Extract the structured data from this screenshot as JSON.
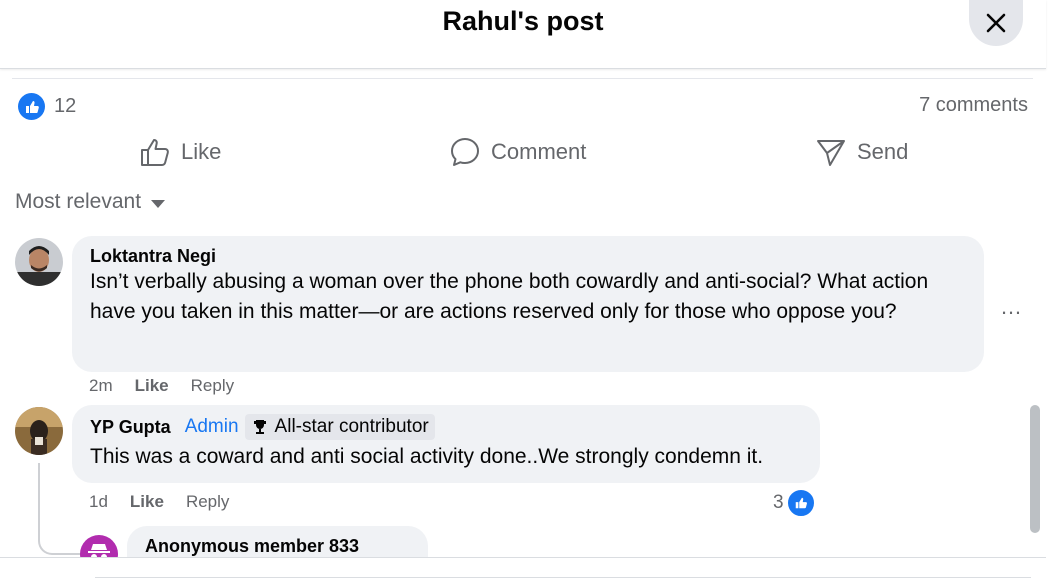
{
  "header": {
    "title": "Rahul's post"
  },
  "stats": {
    "reaction_count": "12",
    "comments_count": "7 comments"
  },
  "actions": {
    "like": "Like",
    "comment": "Comment",
    "send": "Send"
  },
  "sort": {
    "label": "Most relevant"
  },
  "comments": [
    {
      "author": "Loktantra Negi",
      "text": "Isn’t verbally abusing a woman over the phone both cowardly and anti-social? What action have you taken in this matter—or are actions reserved only for those who oppose you?",
      "time": "2m",
      "like": "Like",
      "reply": "Reply",
      "more": "…"
    },
    {
      "author": "YP Gupta",
      "role": "Admin",
      "badge": "All-star contributor",
      "text": "This was a coward and anti social activity done..We strongly condemn it.",
      "time": "1d",
      "like": "Like",
      "reply": "Reply",
      "reactions": "3"
    },
    {
      "author": "Anonymous member 833"
    }
  ],
  "colors": {
    "accent": "#1877f2",
    "bubble": "#f0f2f5",
    "muted": "#65676b"
  },
  "icons": [
    "close-icon",
    "like-reaction-icon",
    "thumbs-up-icon",
    "comment-icon",
    "send-icon",
    "caret-down-icon",
    "trophy-icon",
    "more-icon",
    "anonymous-icon"
  ]
}
